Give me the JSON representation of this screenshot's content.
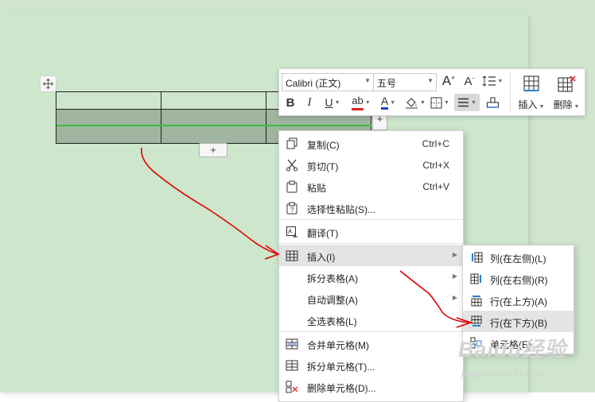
{
  "toolbar": {
    "font_name": "Calibri (正文)",
    "font_size": "五号",
    "bold_label": "B",
    "italic_label": "I",
    "underline_label": "U",
    "strike_label": "ab",
    "font_color_label": "A",
    "grow_font_label": "A",
    "shrink_font_label": "A",
    "insert_label": "插入",
    "delete_label": "删除",
    "accent_colors": {
      "highlight": "#e02020",
      "font_color": "#2040d0"
    }
  },
  "table": {
    "add_row_label": "+",
    "add_col_label": "+"
  },
  "context_menu": {
    "items": [
      {
        "label": "复制(C)",
        "shortcut": "Ctrl+C",
        "icon": "copy-icon"
      },
      {
        "label": "剪切(T)",
        "shortcut": "Ctrl+X",
        "icon": "scissors-icon"
      },
      {
        "label": "粘贴",
        "shortcut": "Ctrl+V",
        "icon": "paste-icon"
      },
      {
        "label": "选择性粘贴(S)...",
        "shortcut": "",
        "icon": "paste-special-icon"
      },
      {
        "label": "翻译(T)",
        "shortcut": "",
        "icon": "translate-icon"
      },
      {
        "label": "插入(I)",
        "shortcut": "",
        "icon": "table-insert-icon",
        "submenu": true,
        "highlighted": true
      },
      {
        "label": "拆分表格(A)",
        "shortcut": "",
        "icon": "",
        "submenu": true
      },
      {
        "label": "自动调整(A)",
        "shortcut": "",
        "icon": "",
        "submenu": true
      },
      {
        "label": "全选表格(L)",
        "shortcut": "",
        "icon": ""
      },
      {
        "label": "合并单元格(M)",
        "shortcut": "",
        "icon": "merge-cells-icon"
      },
      {
        "label": "拆分单元格(T)...",
        "shortcut": "",
        "icon": "split-cells-icon"
      },
      {
        "label": "删除单元格(D)...",
        "shortcut": "",
        "icon": "delete-cells-icon"
      }
    ]
  },
  "insert_submenu": {
    "items": [
      {
        "label": "列(在左侧)(L)",
        "icon": "insert-col-left-icon"
      },
      {
        "label": "列(在右侧)(R)",
        "icon": "insert-col-right-icon"
      },
      {
        "label": "行(在上方)(A)",
        "icon": "insert-row-above-icon"
      },
      {
        "label": "行(在下方)(B)",
        "icon": "insert-row-below-icon",
        "highlighted": true
      },
      {
        "label": "单元格(E)...",
        "icon": "insert-cell-icon"
      }
    ]
  },
  "watermark": {
    "logo": "Baidu经验",
    "sub": "jingyan.baidu.com"
  },
  "colors": {
    "page": "#cde6cc",
    "selection": "#9fb59f",
    "arrow": "#e00000"
  }
}
